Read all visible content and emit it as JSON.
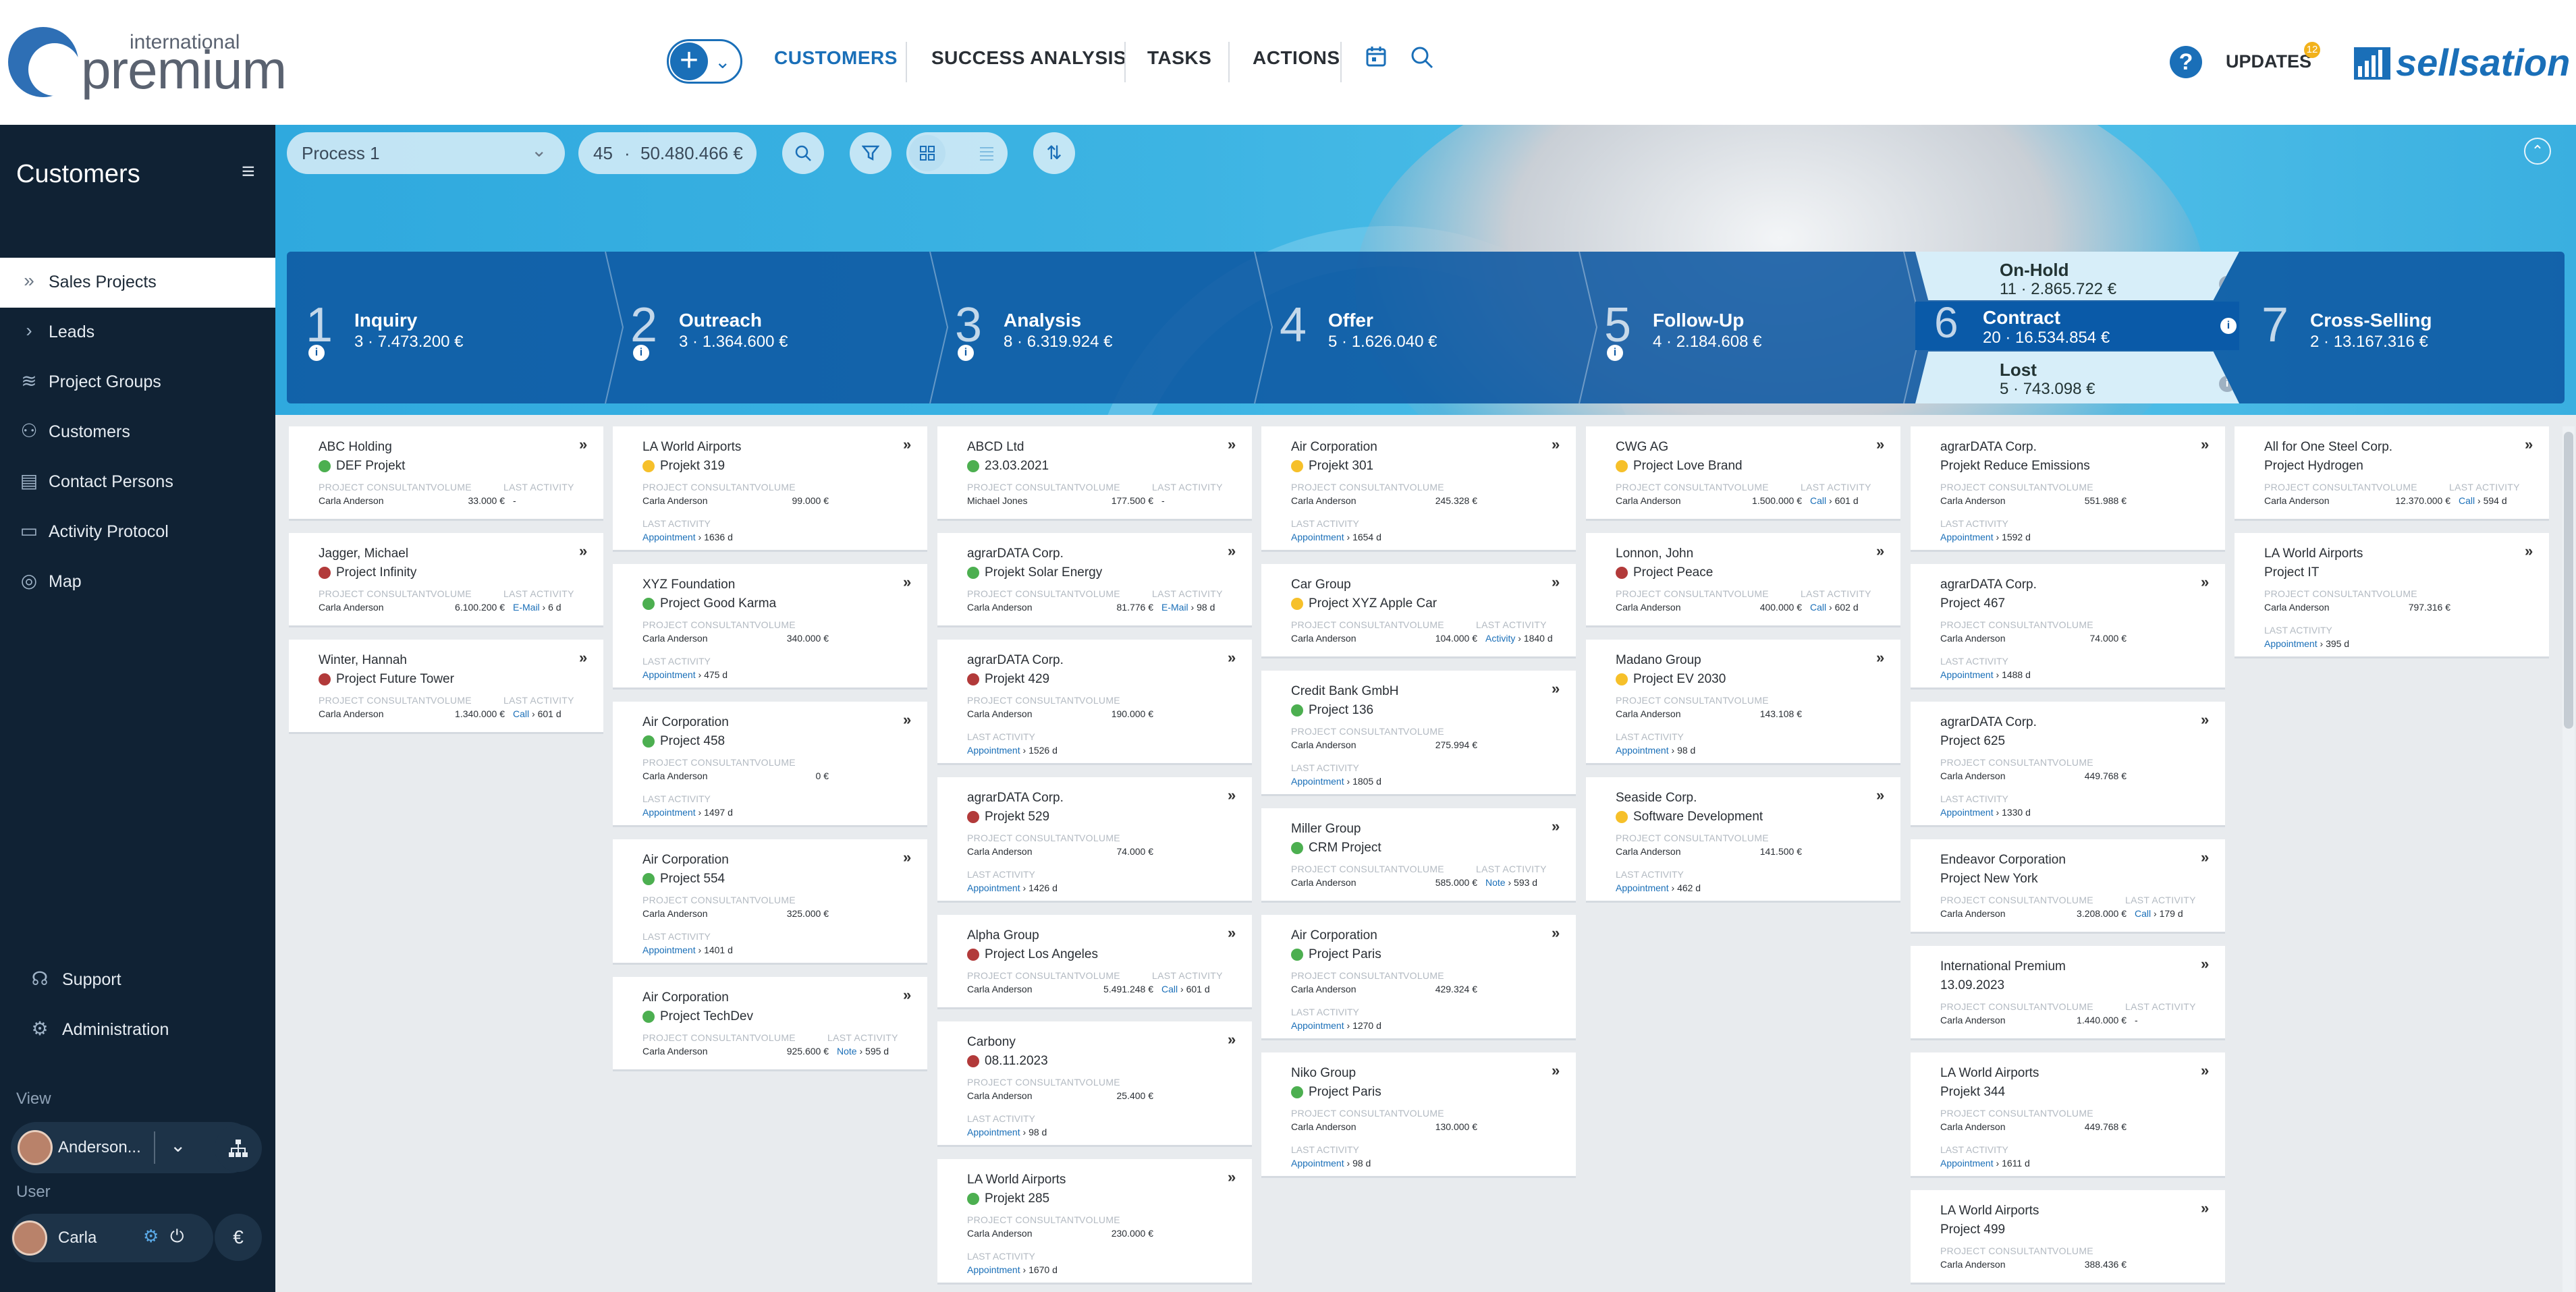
{
  "header": {
    "logo_small": "international",
    "logo_big": "premium",
    "nav": [
      {
        "label": "CUSTOMERS",
        "active": true
      },
      {
        "label": "SUCCESS ANALYSIS",
        "active": false
      },
      {
        "label": "TASKS",
        "active": false
      },
      {
        "label": "ACTIONS",
        "active": false
      }
    ],
    "help_label": "?",
    "updates_label": "UPDATES",
    "updates_badge": "12",
    "brand": "sellsation"
  },
  "sidebar": {
    "title": "Customers",
    "items": [
      {
        "label": "Sales Projects",
        "icon": "double-chevron-icon",
        "active": true
      },
      {
        "label": "Leads",
        "icon": "chevron-icon",
        "active": false
      },
      {
        "label": "Project Groups",
        "icon": "layers-icon",
        "active": false
      },
      {
        "label": "Customers",
        "icon": "people-icon",
        "active": false
      },
      {
        "label": "Contact Persons",
        "icon": "contact-card-icon",
        "active": false
      },
      {
        "label": "Activity Protocol",
        "icon": "protocol-icon",
        "active": false
      },
      {
        "label": "Map",
        "icon": "globe-icon",
        "active": false
      }
    ],
    "bottom_items": [
      {
        "label": "Support",
        "icon": "support-icon"
      },
      {
        "label": "Administration",
        "icon": "gear-icon"
      }
    ],
    "view_label": "View",
    "view_user": "Anderson...",
    "user_label": "User",
    "user_name": "Carla",
    "currency": "€"
  },
  "toolbar": {
    "process_select": "Process 1",
    "count": "45",
    "separator": "·",
    "total": "50.480.466 €"
  },
  "stages": [
    {
      "num": "1",
      "name": "Inquiry",
      "count": "3",
      "amount": "7.473.200 €",
      "info": true
    },
    {
      "num": "2",
      "name": "Outreach",
      "count": "3",
      "amount": "1.364.600 €",
      "info": true
    },
    {
      "num": "3",
      "name": "Analysis",
      "count": "8",
      "amount": "6.319.924 €",
      "info": true
    },
    {
      "num": "4",
      "name": "Offer",
      "count": "5",
      "amount": "1.626.040 €",
      "info": false
    },
    {
      "num": "5",
      "name": "Follow-Up",
      "count": "4",
      "amount": "2.184.608 €",
      "info": true
    },
    {
      "num": "6",
      "name": "Contract",
      "count": "20",
      "amount": "16.534.854 €",
      "info": true
    },
    {
      "num": "7",
      "name": "Cross-Selling",
      "count": "2",
      "amount": "13.167.316 €",
      "info": false
    }
  ],
  "stage_onhold": {
    "name": "On-Hold",
    "count": "11",
    "amount": "2.865.722 €"
  },
  "stage_lost": {
    "name": "Lost",
    "count": "5",
    "amount": "743.098 €"
  },
  "stage_sep": " · ",
  "labels": {
    "consultant": "PROJECT CONSULTANT",
    "volume": "VOLUME",
    "last_activity": "LAST ACTIVITY",
    "expand": "»"
  },
  "status_colors": {
    "green": "#4caf50",
    "yellow": "#f6c02a",
    "red": "#b23a3a"
  },
  "columns": [
    {
      "cards": [
        {
          "company": "ABC Holding",
          "project": "DEF Projekt",
          "status": "green",
          "consultant": "Carla Anderson",
          "volume": "33.000 €",
          "activity_type": "",
          "activity_days": "-",
          "layout": "inline"
        },
        {
          "company": "Jagger, Michael",
          "project": "Project Infinity",
          "status": "red",
          "consultant": "Carla Anderson",
          "volume": "6.100.200 €",
          "activity_type": "E-Mail",
          "activity_days": "6 d",
          "layout": "inline"
        },
        {
          "company": "Winter, Hannah",
          "project": "Project Future Tower",
          "status": "red",
          "consultant": "Carla Anderson",
          "volume": "1.340.000 €",
          "activity_type": "Call",
          "activity_days": "601 d",
          "layout": "inline"
        }
      ]
    },
    {
      "cards": [
        {
          "company": "LA World Airports",
          "project": "Projekt 319",
          "status": "yellow",
          "consultant": "Carla Anderson",
          "volume": "99.000 €",
          "activity_type": "Appointment",
          "activity_days": "1636 d",
          "layout": "below"
        },
        {
          "company": "XYZ Foundation",
          "project": "Project Good Karma",
          "status": "green",
          "consultant": "Carla Anderson",
          "volume": "340.000 €",
          "activity_type": "Appointment",
          "activity_days": "475 d",
          "layout": "below"
        },
        {
          "company": "Air Corporation",
          "project": "Project 458",
          "status": "green",
          "consultant": "Carla Anderson",
          "volume": "0 €",
          "activity_type": "Appointment",
          "activity_days": "1497 d",
          "layout": "below"
        },
        {
          "company": "Air Corporation",
          "project": "Project 554",
          "status": "green",
          "consultant": "Carla Anderson",
          "volume": "325.000 €",
          "activity_type": "Appointment",
          "activity_days": "1401 d",
          "layout": "below"
        },
        {
          "company": "Air Corporation",
          "project": "Project TechDev",
          "status": "green",
          "consultant": "Carla Anderson",
          "volume": "925.600 €",
          "activity_type": "Note",
          "activity_days": "595 d",
          "layout": "inline"
        }
      ]
    },
    {
      "cards": [
        {
          "company": "ABCD Ltd",
          "project": "23.03.2021",
          "status": "green",
          "consultant": "Michael Jones",
          "volume": "177.500 €",
          "activity_type": "",
          "activity_days": "-",
          "layout": "inline"
        },
        {
          "company": "agrarDATA Corp.",
          "project": "Projekt Solar Energy",
          "status": "green",
          "consultant": "Carla Anderson",
          "volume": "81.776 €",
          "activity_type": "E-Mail",
          "activity_days": "98 d",
          "layout": "inline"
        },
        {
          "company": "agrarDATA Corp.",
          "project": "Projekt 429",
          "status": "red",
          "consultant": "Carla Anderson",
          "volume": "190.000 €",
          "activity_type": "Appointment",
          "activity_days": "1526 d",
          "layout": "below"
        },
        {
          "company": "agrarDATA Corp.",
          "project": "Projekt 529",
          "status": "red",
          "consultant": "Carla Anderson",
          "volume": "74.000 €",
          "activity_type": "Appointment",
          "activity_days": "1426 d",
          "layout": "below"
        },
        {
          "company": "Alpha Group",
          "project": "Project Los Angeles",
          "status": "red",
          "consultant": "Carla Anderson",
          "volume": "5.491.248 €",
          "activity_type": "Call",
          "activity_days": "601 d",
          "layout": "inline"
        },
        {
          "company": "Carbony",
          "project": "08.11.2023",
          "status": "red",
          "consultant": "Carla Anderson",
          "volume": "25.400 €",
          "activity_type": "Appointment",
          "activity_days": "98 d",
          "layout": "below"
        },
        {
          "company": "LA World Airports",
          "project": "Projekt 285",
          "status": "green",
          "consultant": "Carla Anderson",
          "volume": "230.000 €",
          "activity_type": "Appointment",
          "activity_days": "1670 d",
          "layout": "below"
        }
      ]
    },
    {
      "cards": [
        {
          "company": "Air Corporation",
          "project": "Projekt 301",
          "status": "yellow",
          "consultant": "Carla Anderson",
          "volume": "245.328 €",
          "activity_type": "Appointment",
          "activity_days": "1654 d",
          "layout": "below"
        },
        {
          "company": "Car Group",
          "project": "Project XYZ Apple Car",
          "status": "yellow",
          "consultant": "Carla Anderson",
          "volume": "104.000 €",
          "activity_type": "Activity",
          "activity_days": "1840 d",
          "layout": "inline"
        },
        {
          "company": "Credit Bank GmbH",
          "project": "Project 136",
          "status": "green",
          "consultant": "Carla Anderson",
          "volume": "275.994 €",
          "activity_type": "Appointment",
          "activity_days": "1805 d",
          "layout": "below"
        },
        {
          "company": "Miller Group",
          "project": "CRM Project",
          "status": "green",
          "consultant": "Carla Anderson",
          "volume": "585.000 €",
          "activity_type": "Note",
          "activity_days": "593 d",
          "layout": "inline"
        },
        {
          "company": "Air Corporation",
          "project": "Project Paris",
          "status": "green",
          "consultant": "Carla Anderson",
          "volume": "429.324 €",
          "activity_type": "Appointment",
          "activity_days": "1270 d",
          "layout": "below"
        },
        {
          "company": "Niko Group",
          "project": "Project Paris",
          "status": "green",
          "consultant": "Carla Anderson",
          "volume": "130.000 €",
          "activity_type": "Appointment",
          "activity_days": "98 d",
          "layout": "below"
        }
      ]
    },
    {
      "cards": [
        {
          "company": "CWG AG",
          "project": "Project Love Brand",
          "status": "yellow",
          "consultant": "Carla Anderson",
          "volume": "1.500.000 €",
          "activity_type": "Call",
          "activity_days": "601 d",
          "layout": "inline"
        },
        {
          "company": "Lonnon, John",
          "project": "Project Peace",
          "status": "red",
          "consultant": "Carla Anderson",
          "volume": "400.000 €",
          "activity_type": "Call",
          "activity_days": "602 d",
          "layout": "inline"
        },
        {
          "company": "Madano Group",
          "project": "Project EV 2030",
          "status": "yellow",
          "consultant": "Carla Anderson",
          "volume": "143.108 €",
          "activity_type": "Appointment",
          "activity_days": "98 d",
          "layout": "below"
        },
        {
          "company": "Seaside Corp.",
          "project": "Software Development",
          "status": "yellow",
          "consultant": "Carla Anderson",
          "volume": "141.500 €",
          "activity_type": "Appointment",
          "activity_days": "462 d",
          "layout": "below"
        }
      ]
    },
    {
      "cards": [
        {
          "company": "agrarDATA Corp.",
          "project": "Projekt Reduce Emissions",
          "status": "",
          "consultant": "Carla Anderson",
          "volume": "551.988 €",
          "activity_type": "Appointment",
          "activity_days": "1592 d",
          "layout": "below"
        },
        {
          "company": "agrarDATA Corp.",
          "project": "Project 467",
          "status": "",
          "consultant": "Carla Anderson",
          "volume": "74.000 €",
          "activity_type": "Appointment",
          "activity_days": "1488 d",
          "layout": "below"
        },
        {
          "company": "agrarDATA Corp.",
          "project": "Project 625",
          "status": "",
          "consultant": "Carla Anderson",
          "volume": "449.768 €",
          "activity_type": "Appointment",
          "activity_days": "1330 d",
          "layout": "below"
        },
        {
          "company": "Endeavor Corporation",
          "project": "Project New York",
          "status": "",
          "consultant": "Carla Anderson",
          "volume": "3.208.000 €",
          "activity_type": "Call",
          "activity_days": "179 d",
          "layout": "inline"
        },
        {
          "company": "International Premium",
          "project": "13.09.2023",
          "status": "",
          "consultant": "Carla Anderson",
          "volume": "1.440.000 €",
          "activity_type": "",
          "activity_days": "-",
          "layout": "inline"
        },
        {
          "company": "LA World Airports",
          "project": "Projekt 344",
          "status": "",
          "consultant": "Carla Anderson",
          "volume": "449.768 €",
          "activity_type": "Appointment",
          "activity_days": "1611 d",
          "layout": "below"
        },
        {
          "company": "LA World Airports",
          "project": "Project 499",
          "status": "",
          "consultant": "Carla Anderson",
          "volume": "388.436 €",
          "activity_type": "",
          "activity_days": "",
          "layout": "none"
        }
      ]
    },
    {
      "cards": [
        {
          "company": "All for One Steel Corp.",
          "project": "Project Hydrogen",
          "status": "",
          "consultant": "Carla Anderson",
          "volume": "12.370.000 €",
          "activity_type": "Call",
          "activity_days": "594 d",
          "layout": "inline"
        },
        {
          "company": "LA World Airports",
          "project": "Project IT",
          "status": "",
          "consultant": "Carla Anderson",
          "volume": "797.316 €",
          "activity_type": "Appointment",
          "activity_days": "395 d",
          "layout": "below"
        }
      ]
    }
  ]
}
